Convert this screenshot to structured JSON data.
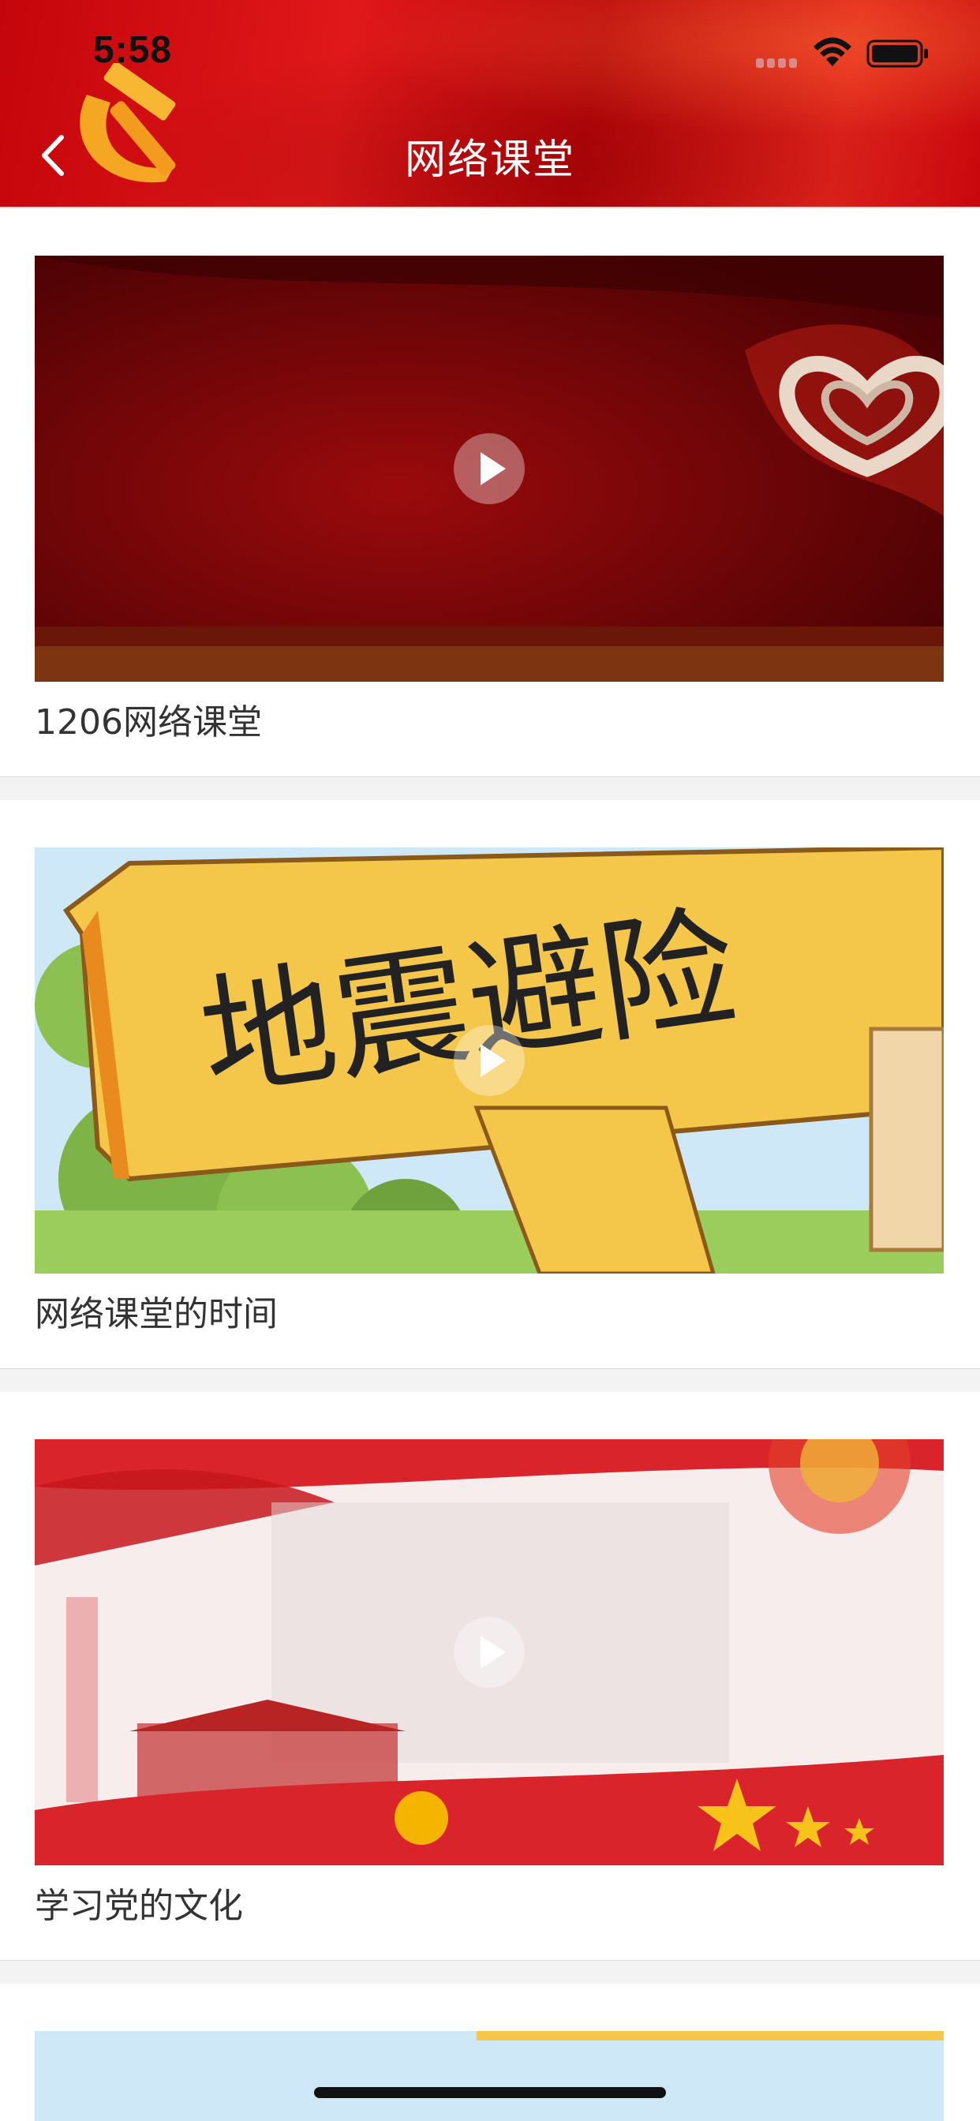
{
  "status_bar": {
    "time": "5:58"
  },
  "header": {
    "title": "网络课堂"
  },
  "videos": [
    {
      "title": "1206网络课堂",
      "thumbnail": "red-stage-heart-banner"
    },
    {
      "title": "网络课堂的时间",
      "thumbnail": "earthquake-cartoon-sign",
      "sign_text": "地震避险"
    },
    {
      "title": "学习党的文化",
      "thumbnail": "party-culture-red-banner"
    }
  ],
  "colors": {
    "header_red": "#d6121a",
    "text": "#333333",
    "divider": "#f3f3f3"
  },
  "icons": {
    "back": "chevron-left-icon",
    "play": "play-icon",
    "emblem": "hammer-sickle-icon",
    "wifi": "wifi-icon",
    "battery": "battery-icon",
    "signal": "signal-icon"
  }
}
